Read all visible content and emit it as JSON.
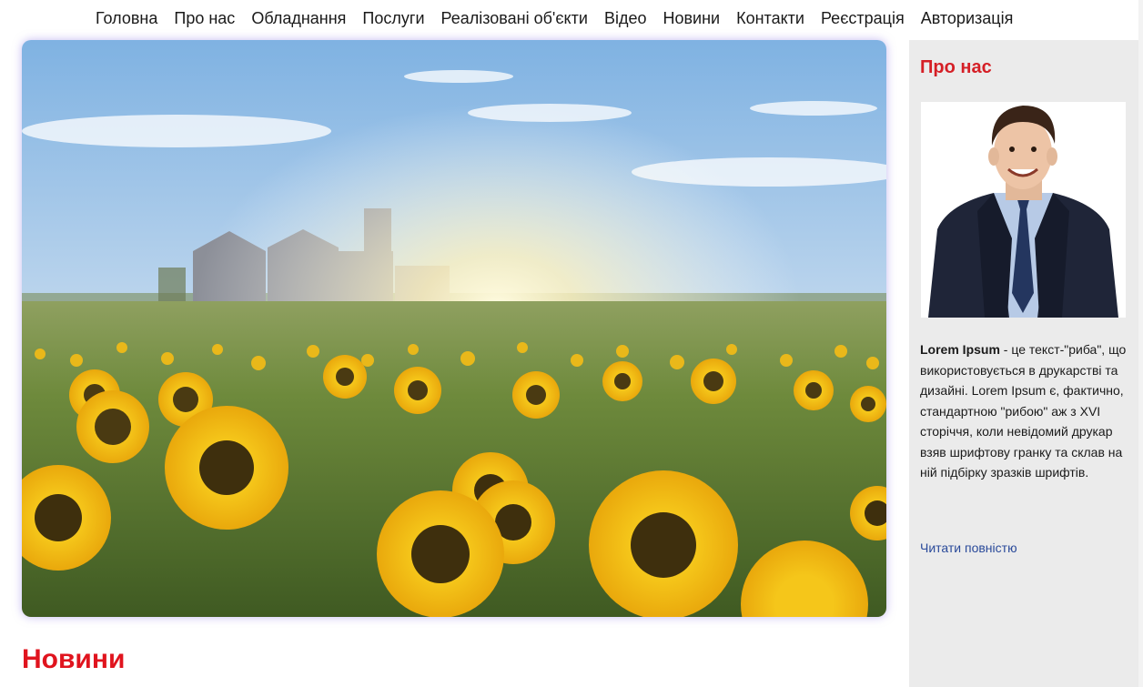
{
  "nav": {
    "items": [
      {
        "label": "Головна"
      },
      {
        "label": "Про нас"
      },
      {
        "label": "Обладнання"
      },
      {
        "label": "Послуги"
      },
      {
        "label": "Реалізовані об'єкти"
      },
      {
        "label": "Відео"
      },
      {
        "label": "Новини"
      },
      {
        "label": "Контакти"
      },
      {
        "label": "Реєстрація"
      },
      {
        "label": "Авторизація"
      }
    ]
  },
  "hero": {
    "image": "sunflower-field-with-grain-silos-photo"
  },
  "news": {
    "title": "Новини"
  },
  "sidebar": {
    "title": "Про нас",
    "avatar": "businessman-portrait-photo",
    "text_bold": "Lorem Ipsum",
    "text_rest": " - це текст-\"риба\", що використовується в друкарстві та дизайні. Lorem Ipsum є, фактично, стандартною \"рибою\" аж з XVI сторіччя, коли невідомий друкар взяв шрифтову гранку та склав на ній підбірку зразків шрифтів.",
    "read_more": "Читати повністю"
  },
  "colors": {
    "accent": "#e0141e",
    "link": "#2a4a9a",
    "sidebar_bg": "#ebebeb"
  }
}
